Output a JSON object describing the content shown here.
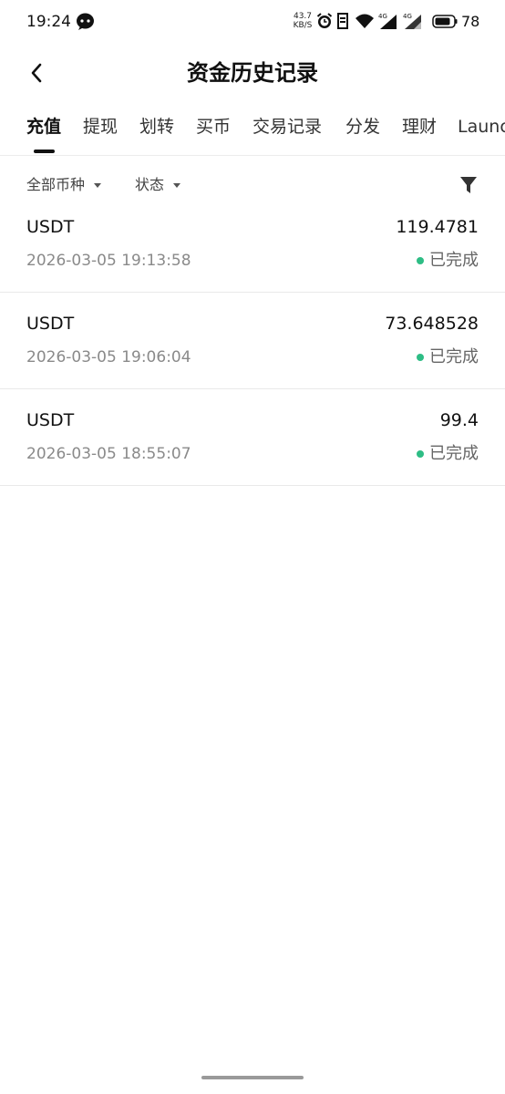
{
  "status_bar": {
    "time": "19:24",
    "net_speed_value": "43.7",
    "net_speed_unit": "KB/S",
    "battery": "78",
    "icons": [
      "chat-bubble-icon",
      "alarm-icon",
      "sim-icon",
      "wifi-icon",
      "signal-4g-icon",
      "signal-4g-icon",
      "battery-icon"
    ]
  },
  "header": {
    "title": "资金历史记录"
  },
  "tabs": [
    {
      "label": "充值",
      "active": true
    },
    {
      "label": "提现",
      "active": false
    },
    {
      "label": "划转",
      "active": false
    },
    {
      "label": "买币",
      "active": false
    },
    {
      "label": "交易记录",
      "active": false
    },
    {
      "label": "分发",
      "active": false
    },
    {
      "label": "理财",
      "active": false
    },
    {
      "label": "Launc",
      "active": false
    }
  ],
  "filters": {
    "currency_label": "全部币种",
    "status_label": "状态"
  },
  "records": [
    {
      "coin": "USDT",
      "amount": "119.4781",
      "time": "2026-03-05 19:13:58",
      "status": "已完成"
    },
    {
      "coin": "USDT",
      "amount": "73.648528",
      "time": "2026-03-05 19:06:04",
      "status": "已完成"
    },
    {
      "coin": "USDT",
      "amount": "99.4",
      "time": "2026-03-05 18:55:07",
      "status": "已完成"
    }
  ],
  "colors": {
    "accent": "#111111",
    "status_completed": "#2ebd85",
    "muted_text": "#8a8a8a"
  }
}
